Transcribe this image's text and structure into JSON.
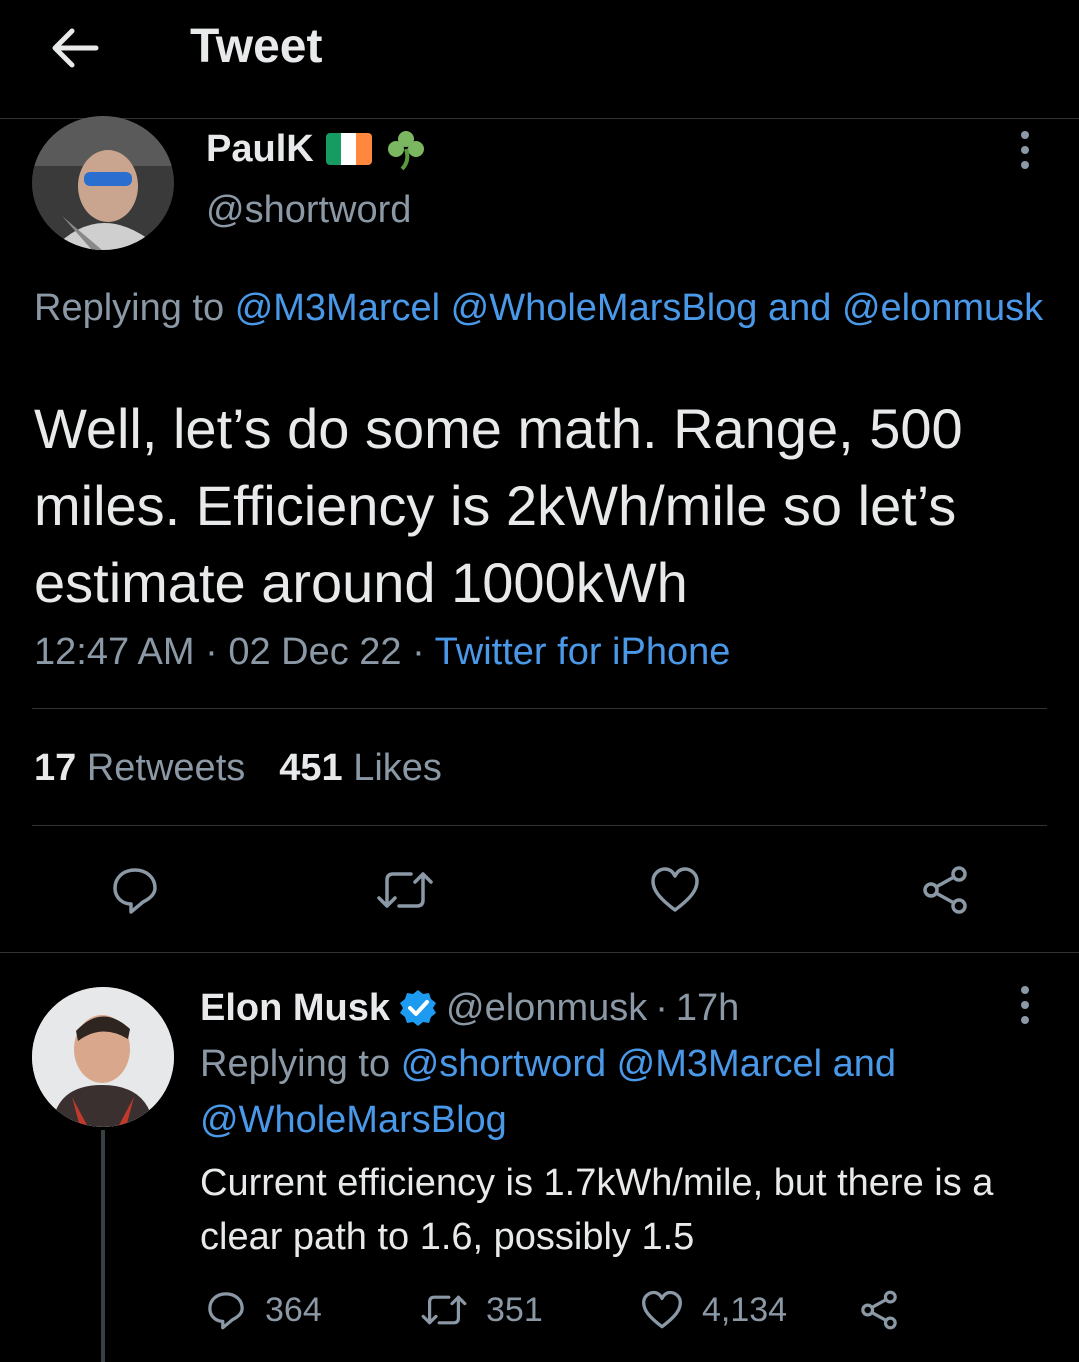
{
  "header": {
    "title": "Tweet"
  },
  "main_tweet": {
    "name": "PaulK",
    "handle": "@shortword",
    "replying_prefix": "Replying to",
    "replying_to_1": "@M3Marcel",
    "replying_to_2": "@WholeMarsBlog",
    "replying_and": "and",
    "replying_to_3": "@elonmusk",
    "text": "Well, let’s do some math. Range, 500 miles. Efficiency is 2kWh/mile so let’s estimate around 1000kWh",
    "time": "12:47 AM",
    "date": "02 Dec 22",
    "sep": "·",
    "source": "Twitter for iPhone",
    "retweets_count": "17",
    "retweets_label": "Retweets",
    "likes_count": "451",
    "likes_label": "Likes"
  },
  "reply_tweet": {
    "name": "Elon Musk",
    "handle": "@elonmusk",
    "sep": "·",
    "age": "17h",
    "replying_prefix": "Replying to",
    "replying_to_1": "@shortword",
    "replying_to_2": "@M3Marcel",
    "replying_and": "and",
    "replying_to_3": "@WholeMarsBlog",
    "text": "Current efficiency is 1.7kWh/mile, but there is a clear path to 1.6, possibly 1.5",
    "replies": "364",
    "retweets": "351",
    "likes": "4,134"
  },
  "icons": [
    "back-arrow-icon",
    "more-icon",
    "shamrock-icon",
    "ireland-flag-icon",
    "verified-badge-icon",
    "reply-icon",
    "retweet-icon",
    "like-icon",
    "share-icon"
  ],
  "colors": {
    "background": "#000000",
    "text": "#e7e9ea",
    "secondary": "#8b98a5",
    "link": "#4a99e9",
    "verified": "#1d9bf0",
    "divider": "#2f3336"
  }
}
